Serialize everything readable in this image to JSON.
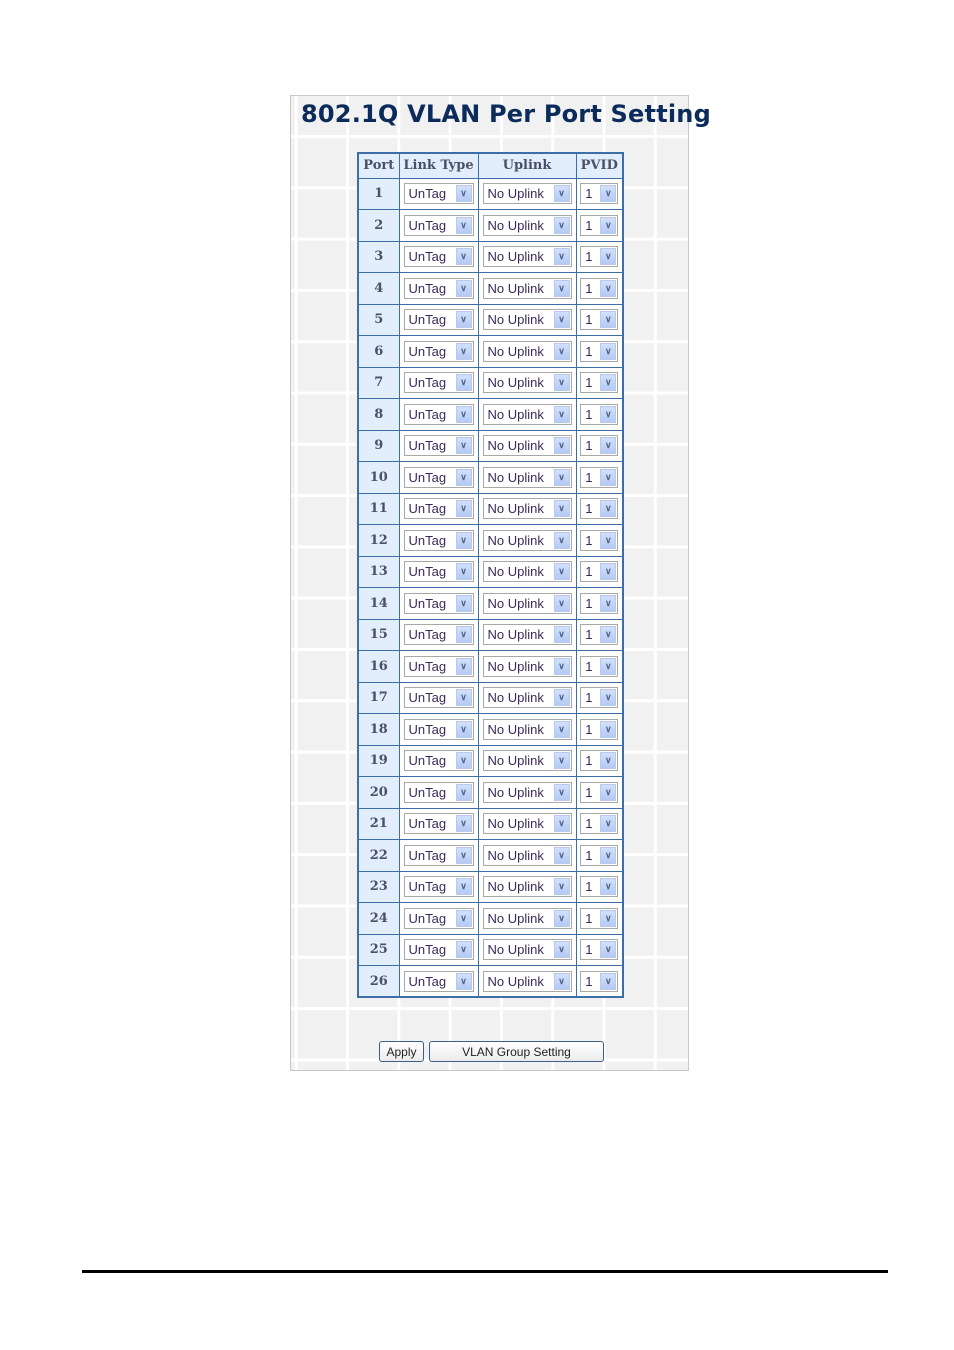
{
  "title": "802.1Q VLAN Per Port Setting",
  "table": {
    "headers": [
      "Port",
      "Link Type",
      "Uplink",
      "PVID"
    ],
    "rows": [
      {
        "port": "1",
        "link_type": "UnTag",
        "uplink": "No Uplink",
        "pvid": "1"
      },
      {
        "port": "2",
        "link_type": "UnTag",
        "uplink": "No Uplink",
        "pvid": "1"
      },
      {
        "port": "3",
        "link_type": "UnTag",
        "uplink": "No Uplink",
        "pvid": "1"
      },
      {
        "port": "4",
        "link_type": "UnTag",
        "uplink": "No Uplink",
        "pvid": "1"
      },
      {
        "port": "5",
        "link_type": "UnTag",
        "uplink": "No Uplink",
        "pvid": "1"
      },
      {
        "port": "6",
        "link_type": "UnTag",
        "uplink": "No Uplink",
        "pvid": "1"
      },
      {
        "port": "7",
        "link_type": "UnTag",
        "uplink": "No Uplink",
        "pvid": "1"
      },
      {
        "port": "8",
        "link_type": "UnTag",
        "uplink": "No Uplink",
        "pvid": "1"
      },
      {
        "port": "9",
        "link_type": "UnTag",
        "uplink": "No Uplink",
        "pvid": "1"
      },
      {
        "port": "10",
        "link_type": "UnTag",
        "uplink": "No Uplink",
        "pvid": "1"
      },
      {
        "port": "11",
        "link_type": "UnTag",
        "uplink": "No Uplink",
        "pvid": "1"
      },
      {
        "port": "12",
        "link_type": "UnTag",
        "uplink": "No Uplink",
        "pvid": "1"
      },
      {
        "port": "13",
        "link_type": "UnTag",
        "uplink": "No Uplink",
        "pvid": "1"
      },
      {
        "port": "14",
        "link_type": "UnTag",
        "uplink": "No Uplink",
        "pvid": "1"
      },
      {
        "port": "15",
        "link_type": "UnTag",
        "uplink": "No Uplink",
        "pvid": "1"
      },
      {
        "port": "16",
        "link_type": "UnTag",
        "uplink": "No Uplink",
        "pvid": "1"
      },
      {
        "port": "17",
        "link_type": "UnTag",
        "uplink": "No Uplink",
        "pvid": "1"
      },
      {
        "port": "18",
        "link_type": "UnTag",
        "uplink": "No Uplink",
        "pvid": "1"
      },
      {
        "port": "19",
        "link_type": "UnTag",
        "uplink": "No Uplink",
        "pvid": "1"
      },
      {
        "port": "20",
        "link_type": "UnTag",
        "uplink": "No Uplink",
        "pvid": "1"
      },
      {
        "port": "21",
        "link_type": "UnTag",
        "uplink": "No Uplink",
        "pvid": "1"
      },
      {
        "port": "22",
        "link_type": "UnTag",
        "uplink": "No Uplink",
        "pvid": "1"
      },
      {
        "port": "23",
        "link_type": "UnTag",
        "uplink": "No Uplink",
        "pvid": "1"
      },
      {
        "port": "24",
        "link_type": "UnTag",
        "uplink": "No Uplink",
        "pvid": "1"
      },
      {
        "port": "25",
        "link_type": "UnTag",
        "uplink": "No Uplink",
        "pvid": "1"
      },
      {
        "port": "26",
        "link_type": "UnTag",
        "uplink": "No Uplink",
        "pvid": "1"
      }
    ]
  },
  "buttons": {
    "apply": "Apply",
    "vlan_group_setting": "VLAN Group Setting"
  },
  "icons": {
    "dropdown_arrow": "chevron-down-icon",
    "dropdown_glyph": "∨"
  },
  "colors": {
    "title": "#0b2b5a",
    "table_border": "#3d6ea5",
    "header_bg": "#e3eefc",
    "panel_bg": "#f1f1f1"
  }
}
